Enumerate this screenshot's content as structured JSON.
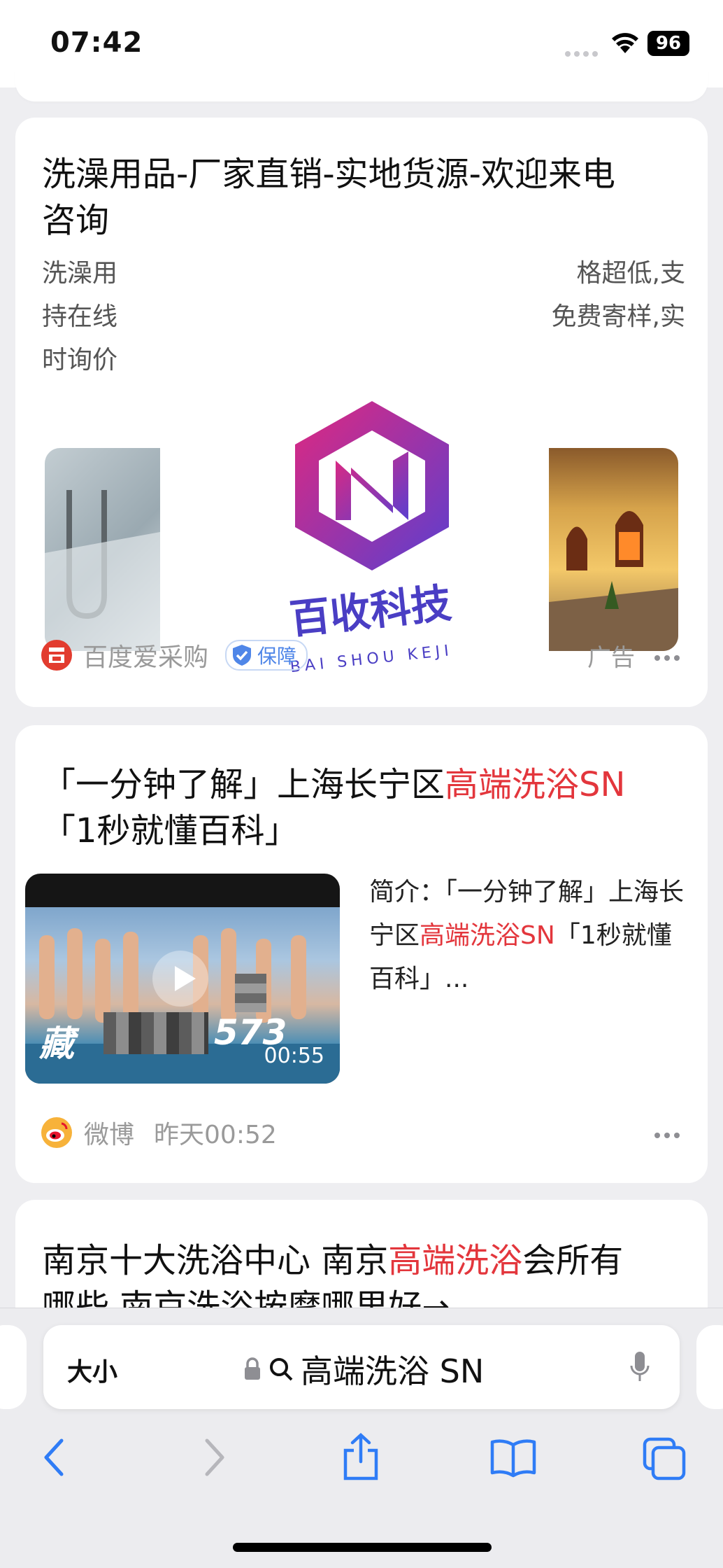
{
  "status": {
    "time": "07:42",
    "battery": "96"
  },
  "ad_card": {
    "title": "洗澡用品-厂家直销-实地货源-欢迎来电咨询",
    "title_line1": "洗澡用品-厂家直销-实地货源-欢迎来电",
    "title_line2": "咨询",
    "desc_l1a": "洗澡用",
    "desc_l1b": "格超低,支",
    "desc_l2a": "持在线",
    "desc_l2b": "免费寄样,实",
    "desc_l3a": "时询价",
    "source": "百度爱采购",
    "badge": "保障",
    "ad_label": "广告",
    "watermark_text_cn": "百收科技",
    "watermark_text_en": "BAI SHOU KEJI"
  },
  "video_card": {
    "title_p1": "「一分钟了解」上海长宁区",
    "title_hl": "高端洗浴SN",
    "title_p2": "「1秒就懂百科」",
    "summary_p1": "简介：「一分钟了解」上海长宁区",
    "summary_hl": "高端洗浴SN",
    "summary_p2": "「1秒就懂百科」...",
    "duration": "00:55",
    "overlay_text": "藏",
    "overlay_num": "573",
    "source": "微博",
    "time": "昨天00:52"
  },
  "third_card": {
    "title_p1": "南京十大洗浴中心 南京",
    "title_hl": "高端洗浴",
    "title_p2": "会所有",
    "title_line2": "哪些 南京洗浴按摩哪里好→"
  },
  "address_bar": {
    "text_size_label": "大小",
    "query": "高端洗浴 SN"
  },
  "icons": [
    "wifi-icon",
    "battery-icon",
    "baidu-logo-icon",
    "shield-check-icon",
    "more-icon",
    "play-icon",
    "weibo-icon",
    "lock-icon",
    "search-icon",
    "mic-icon",
    "back-icon",
    "forward-icon",
    "share-icon",
    "bookmarks-icon",
    "tabs-icon"
  ],
  "colors": {
    "highlight": "#e3363c",
    "accent": "#2f7cf6",
    "watermark_start": "#e0287f",
    "watermark_end": "#5b3fcf"
  }
}
